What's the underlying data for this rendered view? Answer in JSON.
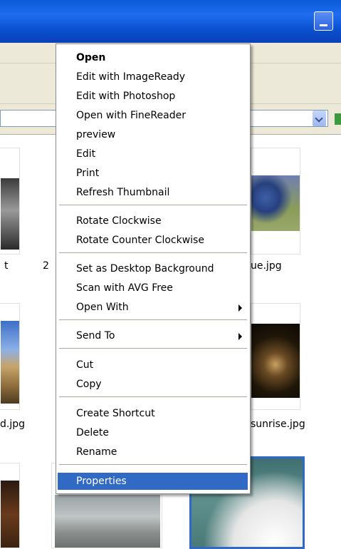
{
  "window": {
    "minimize_icon": "minimize-icon",
    "address_dropdown_icon": "chevron-down-icon"
  },
  "thumbnails": [
    {
      "label": "t"
    },
    {
      "label": "2"
    },
    {
      "label": "ue.jpg"
    },
    {
      "label": "d.jpg"
    },
    {
      "label": "sunrise.jpg"
    }
  ],
  "context_menu": {
    "items": [
      {
        "label": "Open"
      },
      {
        "label": "Edit with ImageReady"
      },
      {
        "label": "Edit with Photoshop"
      },
      {
        "label": "Open with FineReader"
      },
      {
        "label": "preview"
      },
      {
        "label": "Edit"
      },
      {
        "label": "Print"
      },
      {
        "label": "Refresh Thumbnail"
      },
      {
        "label": "Rotate Clockwise"
      },
      {
        "label": "Rotate Counter Clockwise"
      },
      {
        "label": "Set as Desktop Background"
      },
      {
        "label": "Scan with AVG Free"
      },
      {
        "label": "Open With"
      },
      {
        "label": "Send To"
      },
      {
        "label": "Cut"
      },
      {
        "label": "Copy"
      },
      {
        "label": "Create Shortcut"
      },
      {
        "label": "Delete"
      },
      {
        "label": "Rename"
      },
      {
        "label": "Properties"
      }
    ],
    "highlight_color": "#316ac5"
  }
}
